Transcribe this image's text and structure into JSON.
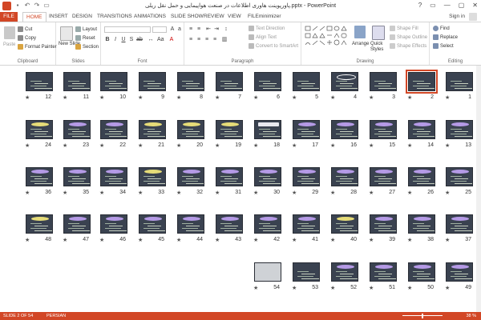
{
  "window": {
    "title": "پاورپوینت هاوری اطلاعات در صنعت هواپیمایی و حمل نقل ریلی.pptx - PowerPoint",
    "controls": [
      "?",
      "▭",
      "—",
      "▢",
      "✕"
    ]
  },
  "tabs": [
    {
      "label": "FILE"
    },
    {
      "label": "HOME"
    },
    {
      "label": "INSERT"
    },
    {
      "label": "DESIGN"
    },
    {
      "label": "TRANSITIONS"
    },
    {
      "label": "ANIMATIONS"
    },
    {
      "label": "SLIDE SHOW"
    },
    {
      "label": "REVIEW"
    },
    {
      "label": "VIEW"
    },
    {
      "label": "FILEminimizer"
    }
  ],
  "account": {
    "signin": "Sign in"
  },
  "ribbon": {
    "clipboard": {
      "label": "Clipboard",
      "paste": "Paste",
      "cut": "Cut",
      "copy": "Copy",
      "format_painter": "Format Painter"
    },
    "slides": {
      "label": "Slides",
      "new_slide": "New Slide",
      "layout": "Layout",
      "reset": "Reset",
      "section": "Section"
    },
    "font": {
      "label": "Font"
    },
    "paragraph": {
      "label": "Paragraph",
      "text_direction": "Text Direction",
      "align_text": "Align Text",
      "convert_smartart": "Convert to SmartArt"
    },
    "drawing": {
      "label": "Drawing",
      "arrange": "Arrange",
      "quick_styles": "Quick Styles",
      "shape_fill": "Shape Fill",
      "shape_outline": "Shape Outline",
      "shape_effects": "Shape Effects"
    },
    "editing": {
      "label": "Editing",
      "find": "Find",
      "replace": "Replace",
      "select": "Select"
    }
  },
  "slides_rows": [
    [
      {
        "n": "12",
        "style": "dark"
      },
      {
        "n": "11",
        "style": "dark"
      },
      {
        "n": "10",
        "style": "dark"
      },
      {
        "n": "9",
        "style": "dark"
      },
      {
        "n": "8",
        "style": "dark"
      },
      {
        "n": "7",
        "style": "dark"
      },
      {
        "n": "6",
        "style": "dark"
      },
      {
        "n": "5",
        "style": "dark"
      },
      {
        "n": "4",
        "style": "white-oval"
      },
      {
        "n": "3",
        "style": "dark"
      },
      {
        "n": "2",
        "style": "selected"
      },
      {
        "n": "1",
        "style": "dark"
      }
    ],
    [
      {
        "n": "24",
        "style": "yellow"
      },
      {
        "n": "23",
        "style": "purple"
      },
      {
        "n": "22",
        "style": "purple"
      },
      {
        "n": "21",
        "style": "yellow"
      },
      {
        "n": "20",
        "style": "yellow"
      },
      {
        "n": "19",
        "style": "yellow"
      },
      {
        "n": "18",
        "style": "white-bar"
      },
      {
        "n": "17",
        "style": "purple"
      },
      {
        "n": "16",
        "style": "purple"
      },
      {
        "n": "15",
        "style": "purple"
      },
      {
        "n": "14",
        "style": "purple"
      },
      {
        "n": "13",
        "style": "purple"
      }
    ],
    [
      {
        "n": "36",
        "style": "purple"
      },
      {
        "n": "35",
        "style": "purple"
      },
      {
        "n": "34",
        "style": "purple"
      },
      {
        "n": "33",
        "style": "yellow"
      },
      {
        "n": "32",
        "style": "purple"
      },
      {
        "n": "31",
        "style": "purple"
      },
      {
        "n": "30",
        "style": "purple"
      },
      {
        "n": "29",
        "style": "purple"
      },
      {
        "n": "28",
        "style": "purple"
      },
      {
        "n": "27",
        "style": "purple"
      },
      {
        "n": "26",
        "style": "purple"
      },
      {
        "n": "25",
        "style": "purple"
      }
    ],
    [
      {
        "n": "48",
        "style": "yellow"
      },
      {
        "n": "47",
        "style": "purple"
      },
      {
        "n": "46",
        "style": "purple"
      },
      {
        "n": "45",
        "style": "purple"
      },
      {
        "n": "44",
        "style": "purple"
      },
      {
        "n": "43",
        "style": "purple"
      },
      {
        "n": "42",
        "style": "purple"
      },
      {
        "n": "41",
        "style": "purple"
      },
      {
        "n": "40",
        "style": "yellow"
      },
      {
        "n": "39",
        "style": "purple"
      },
      {
        "n": "38",
        "style": "purple"
      },
      {
        "n": "37",
        "style": "purple"
      }
    ],
    [
      {
        "n": "54",
        "style": "photo"
      },
      {
        "n": "53",
        "style": "dark"
      },
      {
        "n": "52",
        "style": "purple"
      },
      {
        "n": "51",
        "style": "purple"
      },
      {
        "n": "50",
        "style": "purple"
      },
      {
        "n": "49",
        "style": "purple"
      }
    ]
  ],
  "status": {
    "slide": "SLIDE 2 OF 54",
    "language": "PERSIAN",
    "zoom": "38 %"
  },
  "colors": {
    "accent": "#d24726",
    "purple": "#b59ae6",
    "yellow": "#e6dc78",
    "slide_bg": "#3a4250"
  }
}
